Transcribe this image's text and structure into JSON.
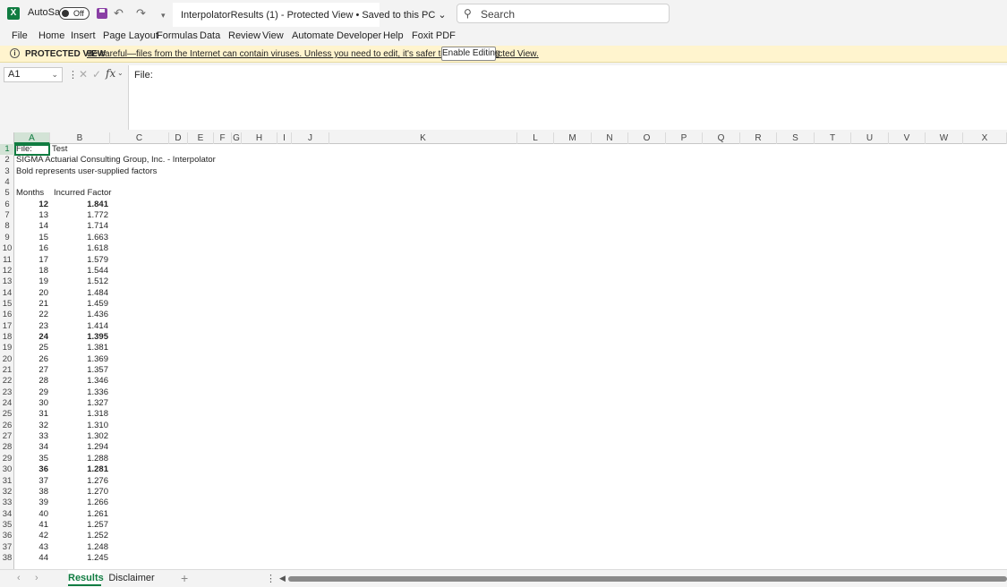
{
  "titlebar": {
    "logo_letter": "X",
    "autosave_label": "AutoSave",
    "autosave_state": "Off",
    "document_title": "InterpolatorResults (1)  -  Protected View • Saved to this PC ⌄",
    "search_placeholder": "Search",
    "undo_glyph": "↶",
    "redo_glyph": "↷",
    "customize_glyph": "▾"
  },
  "menu": [
    "File",
    "Home",
    "Insert",
    "Page Layout",
    "Formulas",
    "Data",
    "Review",
    "View",
    "Automate",
    "Developer",
    "Help",
    "Foxit PDF"
  ],
  "protected_view": {
    "icon_glyph": "i",
    "title": "PROTECTED VIEW",
    "message": "Be careful—files from the Internet can contain viruses. Unless you need to edit, it's safer to stay in Protected View.",
    "button_label": "Enable Editing"
  },
  "formula_bar": {
    "name_box": "A1",
    "formula": "File:",
    "fx": "fx"
  },
  "columns": [
    "A",
    "B",
    "C",
    "D",
    "E",
    "F",
    "G",
    "H",
    "I",
    "J",
    "K",
    "L",
    "M",
    "N",
    "O",
    "P",
    "Q",
    "R",
    "S",
    "T",
    "U",
    "V",
    "W",
    "X"
  ],
  "sheet": {
    "a1": "File:",
    "b1": "Test",
    "a2": "SIGMA Actuarial Consulting Group, Inc. -  Interpolator",
    "a3": "Bold represents user-supplied factors",
    "header_months": "Months",
    "header_factor": "Incurred Factor",
    "rows": [
      {
        "m": "12",
        "f": "1.841",
        "bold": true
      },
      {
        "m": "13",
        "f": "1.772",
        "bold": false
      },
      {
        "m": "14",
        "f": "1.714",
        "bold": false
      },
      {
        "m": "15",
        "f": "1.663",
        "bold": false
      },
      {
        "m": "16",
        "f": "1.618",
        "bold": false
      },
      {
        "m": "17",
        "f": "1.579",
        "bold": false
      },
      {
        "m": "18",
        "f": "1.544",
        "bold": false
      },
      {
        "m": "19",
        "f": "1.512",
        "bold": false
      },
      {
        "m": "20",
        "f": "1.484",
        "bold": false
      },
      {
        "m": "21",
        "f": "1.459",
        "bold": false
      },
      {
        "m": "22",
        "f": "1.436",
        "bold": false
      },
      {
        "m": "23",
        "f": "1.414",
        "bold": false
      },
      {
        "m": "24",
        "f": "1.395",
        "bold": true
      },
      {
        "m": "25",
        "f": "1.381",
        "bold": false
      },
      {
        "m": "26",
        "f": "1.369",
        "bold": false
      },
      {
        "m": "27",
        "f": "1.357",
        "bold": false
      },
      {
        "m": "28",
        "f": "1.346",
        "bold": false
      },
      {
        "m": "29",
        "f": "1.336",
        "bold": false
      },
      {
        "m": "30",
        "f": "1.327",
        "bold": false
      },
      {
        "m": "31",
        "f": "1.318",
        "bold": false
      },
      {
        "m": "32",
        "f": "1.310",
        "bold": false
      },
      {
        "m": "33",
        "f": "1.302",
        "bold": false
      },
      {
        "m": "34",
        "f": "1.294",
        "bold": false
      },
      {
        "m": "35",
        "f": "1.288",
        "bold": false
      },
      {
        "m": "36",
        "f": "1.281",
        "bold": true
      },
      {
        "m": "37",
        "f": "1.276",
        "bold": false
      },
      {
        "m": "38",
        "f": "1.270",
        "bold": false
      },
      {
        "m": "39",
        "f": "1.266",
        "bold": false
      },
      {
        "m": "40",
        "f": "1.261",
        "bold": false
      },
      {
        "m": "41",
        "f": "1.257",
        "bold": false
      },
      {
        "m": "42",
        "f": "1.252",
        "bold": false
      },
      {
        "m": "43",
        "f": "1.248",
        "bold": false
      },
      {
        "m": "44",
        "f": "1.245",
        "bold": false
      }
    ]
  },
  "tabs": {
    "prev_glyph": "‹",
    "next_glyph": "›",
    "sheets": [
      "Results",
      "Disclaimer"
    ],
    "active": "Results",
    "add_glyph": "+"
  },
  "colors": {
    "excel_green": "#107c41",
    "protected_bar": "#fff4ce",
    "chrome": "#f3f3f3"
  }
}
